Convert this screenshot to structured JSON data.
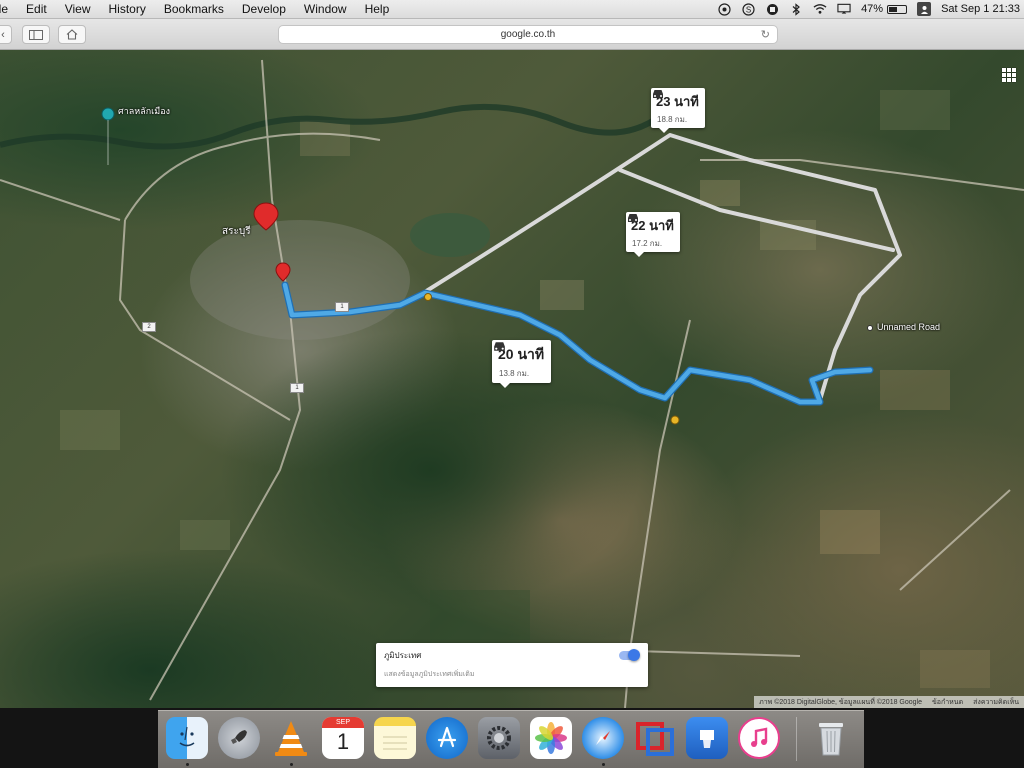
{
  "menubar": {
    "items": [
      "ile",
      "Edit",
      "View",
      "History",
      "Bookmarks",
      "Develop",
      "Window",
      "Help"
    ],
    "battery_percent": "47%",
    "battery_level": 0.47,
    "clock": "Sat Sep 1  21:33",
    "status_icons": [
      "target-icon",
      "skype-icon",
      "recording-icon",
      "bluetooth-icon",
      "wifi-icon",
      "display-icon",
      "battery-icon",
      "user-icon"
    ]
  },
  "browser": {
    "url": "google.co.th",
    "icons": [
      "back-icon",
      "sidebar-icon",
      "home-icon",
      "reload-icon"
    ]
  },
  "map": {
    "view": "satellite",
    "route_color": "#4fa9e6",
    "alt_route_color": "#d9d9d9",
    "destination_label": "Unnamed Road",
    "place_labels": [
      "สระบุรี",
      "ศาลหลักเมือง"
    ],
    "road_shields": [
      "1",
      "1",
      "2"
    ],
    "routes": [
      {
        "time": "23 นาที",
        "distance": "18.8 กม.",
        "selected": false
      },
      {
        "time": "22 นาที",
        "distance": "17.2 กม.",
        "selected": false
      },
      {
        "time": "20 นาที",
        "distance": "13.8 กม.",
        "selected": true
      }
    ],
    "terrain_panel": {
      "title": "ภูมิประเทศ",
      "subtitle": "แสดงข้อมูลภูมิประเทศเพิ่มเติม",
      "toggle_on": true
    },
    "attribution": [
      "ภาพ ©2018 DigitalGlobe, ข้อมูลแผนที่ ©2018 Google",
      "ข้อกำหนด",
      "ส่งความคิดเห็น"
    ]
  },
  "dock": {
    "apps": [
      "Finder",
      "Launchpad",
      "VLC",
      "Calendar",
      "Notes",
      "App Store",
      "System Preferences",
      "Photos",
      "Safari",
      "Parallels",
      "Keynote",
      "iTunes",
      "Trash"
    ],
    "calendar_day": "1",
    "calendar_month": "SEP"
  }
}
